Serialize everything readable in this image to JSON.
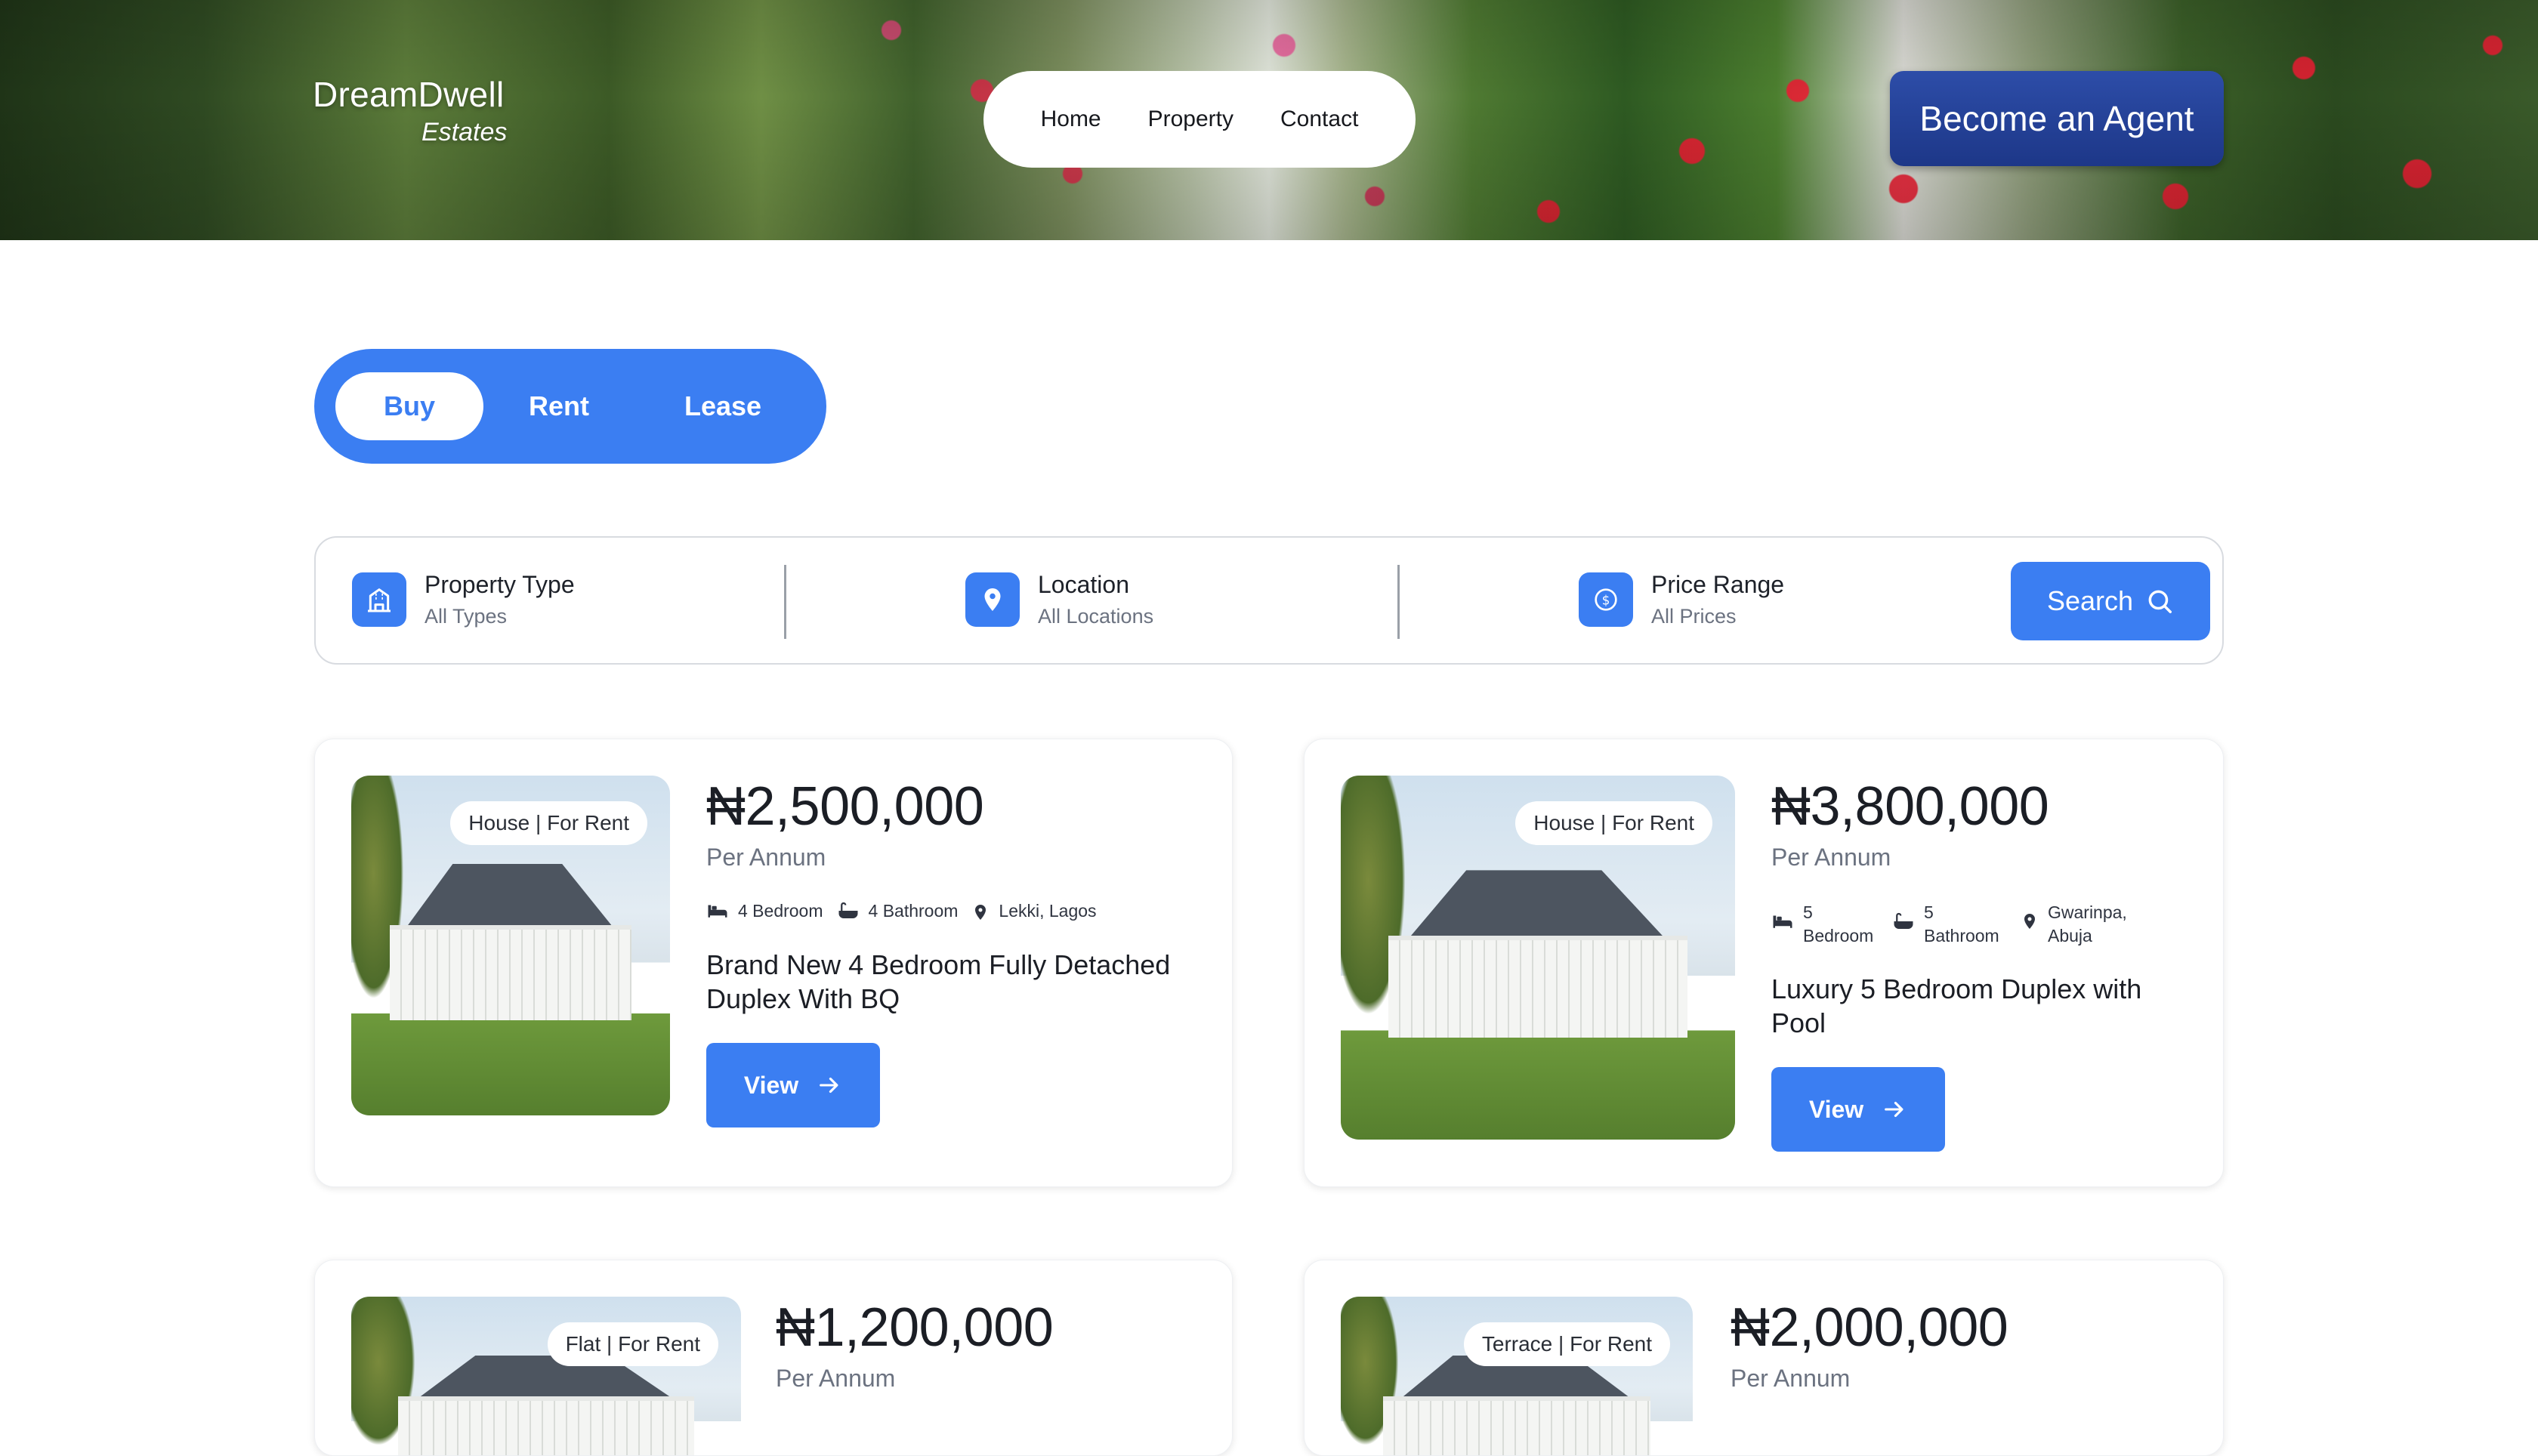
{
  "brand": {
    "name": "DreamDwell",
    "sub": "Estates"
  },
  "nav": {
    "items": [
      "Home",
      "Property",
      "Contact"
    ]
  },
  "header_cta": "Become an Agent",
  "tabs": {
    "items": [
      "Buy",
      "Rent",
      "Lease"
    ],
    "active": "Buy"
  },
  "search": {
    "filters": [
      {
        "label": "Property Type",
        "value": "All Types",
        "icon": "building-icon"
      },
      {
        "label": "Location",
        "value": "All Locations",
        "icon": "location-pin-icon"
      },
      {
        "label": "Price Range",
        "value": "All Prices",
        "icon": "coin-icon"
      }
    ],
    "button": "Search"
  },
  "colors": {
    "accent": "#3b7ef2",
    "agent_button": "#1d3788",
    "text": "#1b1e25",
    "muted": "#6b7280"
  },
  "listings": [
    {
      "badge": "House | For Rent",
      "price": "₦2,500,000",
      "period": "Per Annum",
      "bedrooms": "4 Bedroom",
      "bathrooms": "4 Bathroom",
      "location": "Lekki, Lagos",
      "title": "Brand New 4 Bedroom Fully Detached Duplex With BQ",
      "button": "View"
    },
    {
      "badge": "House | For Rent",
      "price": "₦3,800,000",
      "period": "Per Annum",
      "bedrooms": "5 Bedroom",
      "bathrooms": "5 Bathroom",
      "location": "Gwarinpa, Abuja",
      "title": "Luxury 5 Bedroom Duplex with Pool",
      "button": "View"
    },
    {
      "badge": "Flat | For Rent",
      "price": "₦1,200,000",
      "period": "Per Annum"
    },
    {
      "badge": "Terrace | For Rent",
      "price": "₦2,000,000",
      "period": "Per Annum"
    }
  ]
}
